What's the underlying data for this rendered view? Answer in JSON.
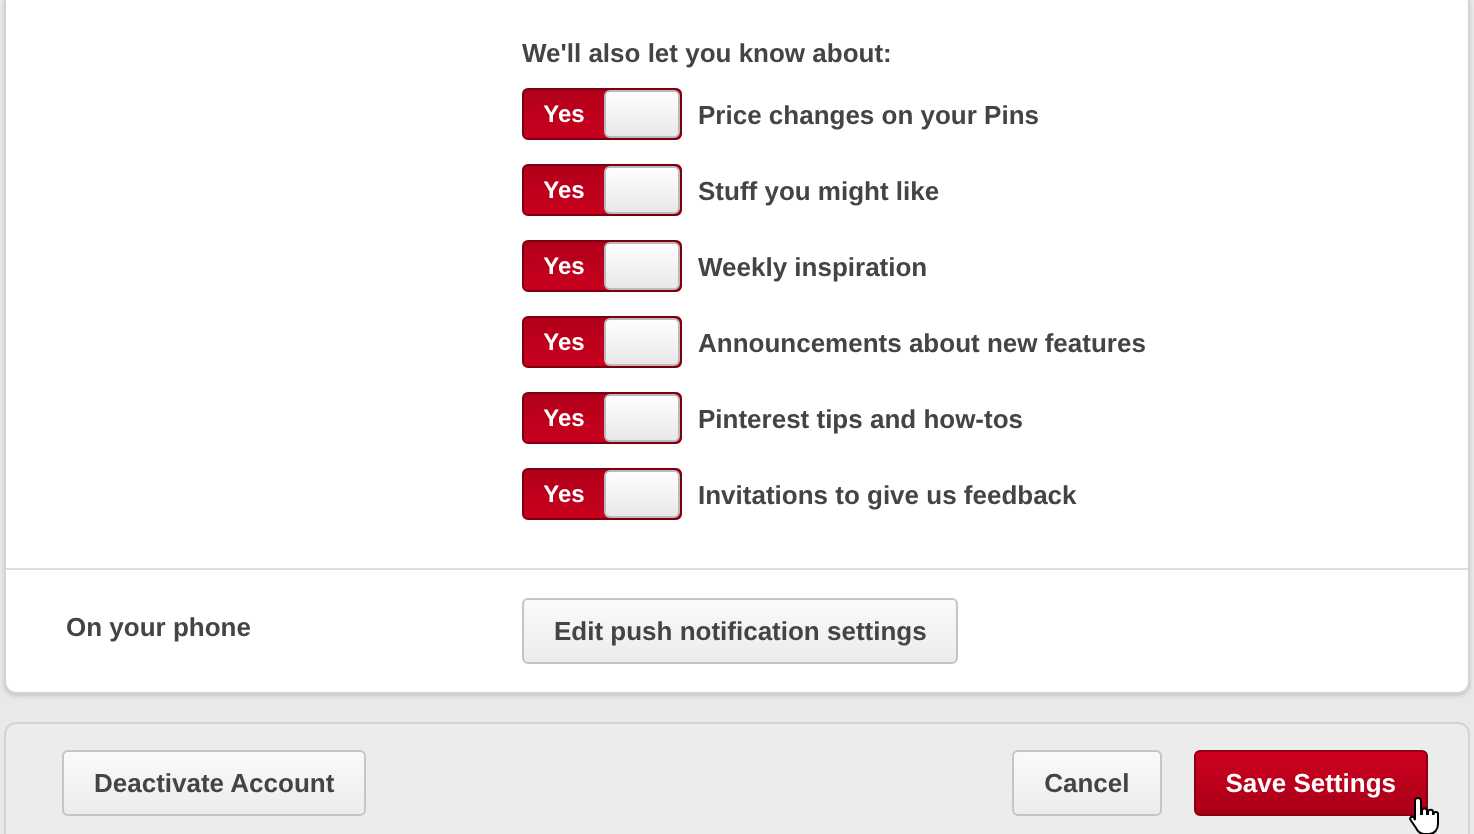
{
  "notifications": {
    "heading": "We'll also let you know about:",
    "items": [
      {
        "label": "Price changes on your Pins",
        "toggle_text": "Yes",
        "on": true
      },
      {
        "label": "Stuff you might like",
        "toggle_text": "Yes",
        "on": true
      },
      {
        "label": "Weekly inspiration",
        "toggle_text": "Yes",
        "on": true
      },
      {
        "label": "Announcements about new features",
        "toggle_text": "Yes",
        "on": true
      },
      {
        "label": "Pinterest tips and how-tos",
        "toggle_text": "Yes",
        "on": true
      },
      {
        "label": "Invitations to give us feedback",
        "toggle_text": "Yes",
        "on": true
      }
    ]
  },
  "phone": {
    "label": "On your phone",
    "button": "Edit push notification settings"
  },
  "footer": {
    "deactivate": "Deactivate Account",
    "cancel": "Cancel",
    "save": "Save Settings"
  }
}
